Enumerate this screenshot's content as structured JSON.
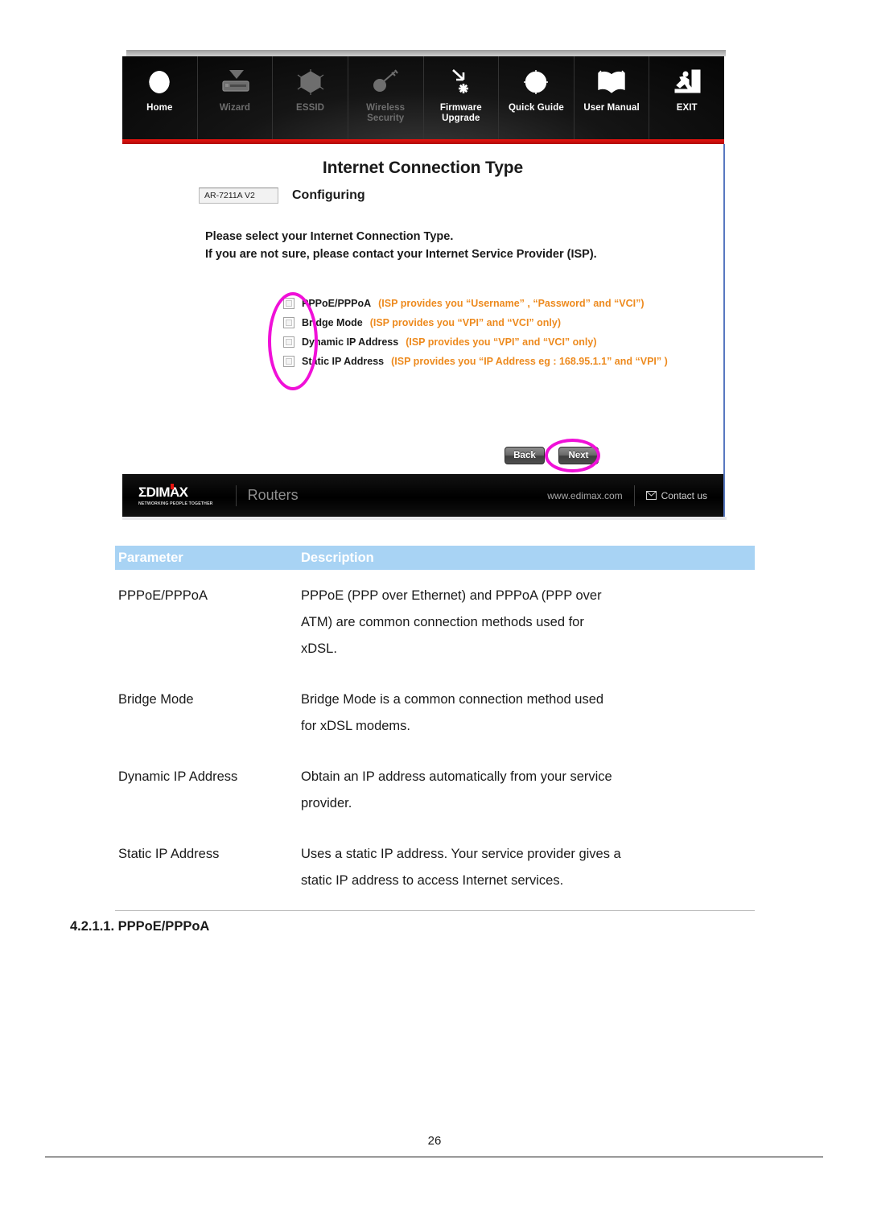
{
  "screenshot": {
    "nav": {
      "items": [
        {
          "label": "Home",
          "icon": "globe-icon",
          "state": "active"
        },
        {
          "label": "Wizard",
          "icon": "wizard-download-icon",
          "state": "dim"
        },
        {
          "label": "ESSID",
          "icon": "essid-web-icon",
          "state": "dim"
        },
        {
          "label": "Wireless\nSecurity",
          "label_line1": "Wireless",
          "label_line2": "Security",
          "icon": "key-icon",
          "state": "dim"
        },
        {
          "label": "Firmware\nUpgrade",
          "label_line1": "Firmware",
          "label_line2": "Upgrade",
          "icon": "firmware-upgrade-icon",
          "state": "active"
        },
        {
          "label": "Quick Guide",
          "icon": "compass-icon",
          "state": "active"
        },
        {
          "label": "User Manual",
          "icon": "open-book-icon",
          "state": "active"
        },
        {
          "label": "EXIT",
          "icon": "exit-door-icon",
          "state": "active"
        }
      ]
    },
    "page": {
      "title": "Internet Connection Type",
      "model": "AR-7211A V2",
      "status": "Configuring",
      "instruction_line1": "Please select your Internet Connection Type.",
      "instruction_line2": "If you are not sure, please contact your Internet Service Provider (ISP).",
      "options": [
        {
          "name": "PPPoE/PPPoA",
          "hint": "(ISP provides you “Username” , “Password” and “VCI”)",
          "checked": false
        },
        {
          "name": "Bridge Mode",
          "hint": "(ISP provides you “VPI” and “VCI” only)",
          "checked": false
        },
        {
          "name": "Dynamic IP Address",
          "hint": "(ISP provides you “VPI” and “VCI” only)",
          "checked": false
        },
        {
          "name": "Static IP Address",
          "hint": "(ISP provides you “IP Address eg : 168.95.1.1” and “VPI” )",
          "checked": false
        }
      ],
      "buttons": {
        "back": "Back",
        "next": "Next"
      }
    },
    "footer": {
      "logo": "ΣDIMAX",
      "tagline": "NETWORKING PEOPLE TOGETHER",
      "category": "Routers",
      "url": "www.edimax.com",
      "contact": "Contact us",
      "contact_icon": "envelope-icon"
    },
    "annotations": {
      "highlight_color": "#f010d8",
      "highlight_checkbox_group": "ellipse around connection type checkboxes",
      "highlight_next_button": "ellipse around Next button"
    }
  },
  "document": {
    "table": {
      "headers": [
        "Parameter",
        "Description"
      ],
      "header_bg": "#a8d3f4",
      "rows": [
        {
          "parameter": "PPPoE/PPPoA",
          "description": [
            "PPPoE (PPP over Ethernet) and PPPoA (PPP over",
            "ATM) are common connection methods used for",
            "xDSL."
          ]
        },
        {
          "parameter": "Bridge Mode",
          "description": [
            "Bridge Mode is a common connection method used",
            "for xDSL modems."
          ]
        },
        {
          "parameter": "Dynamic IP Address",
          "description": [
            "Obtain an IP address automatically from your service",
            "provider."
          ]
        },
        {
          "parameter": "Static IP Address",
          "description": [
            "Uses a static IP address. Your service provider gives a",
            "static IP address to access Internet services."
          ]
        }
      ]
    },
    "section_heading": "4.2.1.1. PPPoE/PPPoA",
    "page_number": "26"
  }
}
